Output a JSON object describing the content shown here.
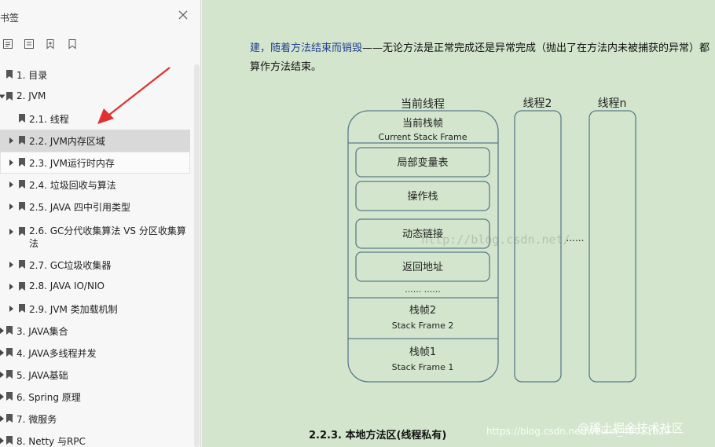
{
  "sidebar": {
    "title": "书签",
    "items": [
      {
        "label": "1. 目录"
      },
      {
        "label": "2. JVM"
      },
      {
        "label": "2.1. 线程"
      },
      {
        "label": "2.2. JVM内存区域"
      },
      {
        "label": "2.3. JVM运行时内存"
      },
      {
        "label": "2.4. 垃圾回收与算法"
      },
      {
        "label": "2.5. JAVA 四中引用类型"
      },
      {
        "label": "2.6. GC分代收集算法  VS 分区收集算法"
      },
      {
        "label": "2.7. GC垃圾收集器"
      },
      {
        "label": "2.8.  JAVA IO/NIO"
      },
      {
        "label": "2.9. JVM 类加载机制"
      },
      {
        "label": "3. JAVA集合"
      },
      {
        "label": "4. JAVA多线程并发"
      },
      {
        "label": "5. JAVA基础"
      },
      {
        "label": "6. Spring 原理"
      },
      {
        "label": "7.  微服务"
      },
      {
        "label": "8. Netty 与RPC"
      }
    ]
  },
  "doc": {
    "para_highlight": "建，随着方法结束而销毁",
    "para_rest": "——无论方法是正常完成还是异常完成（抛出了在方法内未被捕获的异常）都算作方法结束。",
    "diagram": {
      "thread1_label": "当前线程",
      "thread2_label": "线程2",
      "threadn_label": "线程n",
      "current_frame_cn": "当前栈帧",
      "current_frame_en": "Current Stack Frame",
      "local_vars": "局部变量表",
      "operand_stack": "操作栈",
      "dynamic_link": "动态链接",
      "return_addr": "返回地址",
      "ellipsis_inner": "...... ......",
      "frame2_cn": "栈帧2",
      "frame2_en": "Stack Frame 2",
      "frame1_cn": "栈帧1",
      "frame1_en": "Stack Frame 1",
      "ellipsis_between": "......"
    },
    "section_title": "2.2.3.  本地方法区(线程私有)",
    "watermark_center": "http://blog.csdn.net/",
    "watermark_bottom": "https://blog.csdn.net/weixin_45011629",
    "watermark_brand": "@稀土掘金技术社区"
  },
  "colors": {
    "doc_bg": "#d3e6cd",
    "highlight_text": "#1f3f8f",
    "arrow": "#e03030",
    "selected_row": "#d9d9d9"
  }
}
